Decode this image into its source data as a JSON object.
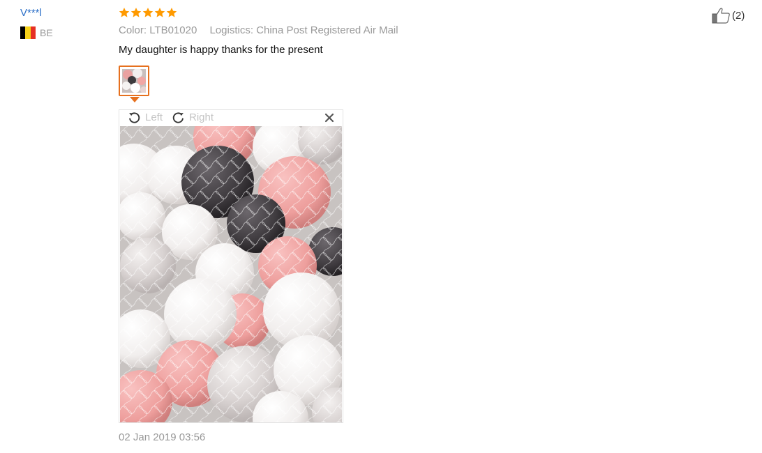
{
  "review": {
    "user_name": "V***l",
    "country_code": "BE",
    "flag_colors": [
      "#000000",
      "#f6d21a",
      "#e63024"
    ],
    "rating": 5,
    "rating_max": 5,
    "star_color": "#ff9a00",
    "color_label": "Color:",
    "color_value": "LTB01020",
    "logistics_label": "Logistics:",
    "logistics_value": "China Post Registered Air Mail",
    "text": "My daughter is happy thanks for the present",
    "date": "02 Jan 2019 03:56",
    "helpful_count": "(2)"
  },
  "viewer": {
    "rotate_left_label": "Left",
    "rotate_right_label": "Right"
  },
  "colors": {
    "accent": "#e6701e",
    "link": "#2d70c8",
    "muted": "#999999"
  }
}
